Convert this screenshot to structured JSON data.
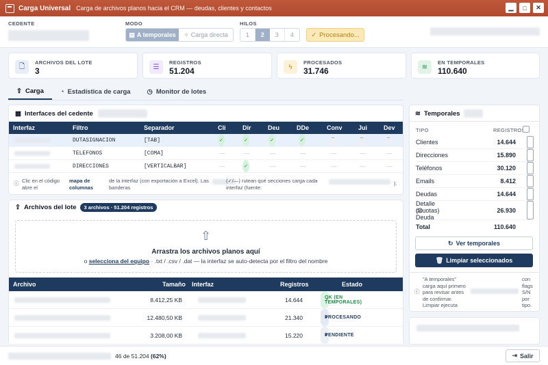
{
  "titlebar": {
    "title": "Carga Universal",
    "subtitle": "Carga de archivos planos hacia el CRM — deudas, clientes y contactos",
    "min": "▁",
    "max": "□",
    "close": "✕"
  },
  "topbar": {
    "cedente_label": "CEDENTE",
    "modo_label": "MODO",
    "modo_options": [
      "A temporales",
      "Carga directa"
    ],
    "hilos_label": "HILOS",
    "hilos_options": [
      "1",
      "2",
      "3",
      "4"
    ],
    "process_label": "Procesando..."
  },
  "stats": [
    {
      "label": "ARCHIVOS DEL LOTE",
      "value": "3",
      "icon": "file-icon"
    },
    {
      "label": "REGISTROS",
      "value": "51.204",
      "icon": "list-icon"
    },
    {
      "label": "PROCESADOS",
      "value": "31.746",
      "icon": "bolt-icon"
    },
    {
      "label": "EN TEMPORALES",
      "value": "110.640",
      "icon": "database-icon"
    }
  ],
  "tabs": [
    "Carga",
    "Estadística de carga",
    "Monitor de lotes"
  ],
  "interfaces": {
    "title": "Interfaces del cedente",
    "columns": [
      "Interfaz",
      "Filtro",
      "Separador",
      "Cli",
      "Dir",
      "Deu",
      "DDe",
      "Conv",
      "Jui",
      "Dev"
    ],
    "rows": [
      {
        "filtro": "DUTASIGNACION",
        "sep": "[TAB]",
        "flags": [
          1,
          1,
          1,
          1,
          0,
          0,
          0
        ]
      },
      {
        "filtro": "TELEFONOS",
        "sep": "[COMA]",
        "flags": [
          2,
          2,
          2,
          2,
          2,
          2,
          2
        ]
      },
      {
        "filtro": "DIRECCIONES",
        "sep": "[VERTICALBAR]",
        "flags": [
          2,
          1,
          2,
          2,
          2,
          2,
          2
        ]
      }
    ],
    "note_a": "Clic en el código abre el",
    "note_b": "mapa de columnas",
    "note_c": "de la interfaz (con exportación a Excel). Las banderas",
    "note_d": "(✓/—) rutean qué secciones carga cada interfaz (fuente:",
    "note_e": ")."
  },
  "archivos": {
    "title": "Archivos del lote",
    "badge": "3 archivos · 51.204 registros",
    "drop_title": "Arrastra los archivos planos aquí",
    "drop_pre": "o",
    "drop_link": "selecciona del equipo",
    "drop_post": "· .txt / .csv / .dat — la interfaz se auto-detecta por el filtro del nombre",
    "columns": [
      "Archivo",
      "Tamaño",
      "Interfaz",
      "Registros",
      "Estado"
    ],
    "rows": [
      {
        "size": "8.412,25 KB",
        "regs": "14.644",
        "estado": "OK (EN TEMPORALES)",
        "color": "#1f8a45",
        "bg": "#ddf3e4",
        "mark": "✓"
      },
      {
        "size": "12.480,50 KB",
        "regs": "21.340",
        "estado": "PROCESANDO",
        "color": "#1e3a5f",
        "bg": "#e4eaf3",
        "mark": "●"
      },
      {
        "size": "3.208,00 KB",
        "regs": "15.220",
        "estado": "PENDIENTE",
        "color": "#1e3a5f",
        "bg": "#eceff3",
        "mark": "●"
      }
    ]
  },
  "temporales": {
    "title": "Temporales",
    "col_tipo": "TIPO",
    "col_reg": "REGISTROS",
    "rows": [
      {
        "tipo": "Clientes",
        "reg": "14.644"
      },
      {
        "tipo": "Direcciones",
        "reg": "15.890"
      },
      {
        "tipo": "Teléfonos",
        "reg": "30.120"
      },
      {
        "tipo": "Emails",
        "reg": "8.412"
      },
      {
        "tipo": "Deudas",
        "reg": "14.644"
      }
    ],
    "detalle_1": "Detalle de Deuda",
    "detalle_2": "(Cuotas)",
    "detalle_reg": "26.930",
    "total_label": "Total",
    "total": "110.640",
    "ver_btn": "Ver temporales",
    "limpiar_btn": "Limpiar seleccionados",
    "note_1": "\"A temporales\"",
    "note_2": "carga aquí primero",
    "note_3": "para revisar antes",
    "note_4": "de confirmar.",
    "note_5": "Limpiar ejecuta",
    "note_r1": "con",
    "note_r2": "flags",
    "note_r3": "S/N",
    "note_r4": "por",
    "note_r5": "tipo."
  },
  "footer": {
    "progress": "46 de 51.204",
    "percent": "(62%)",
    "exit": "Salir"
  }
}
